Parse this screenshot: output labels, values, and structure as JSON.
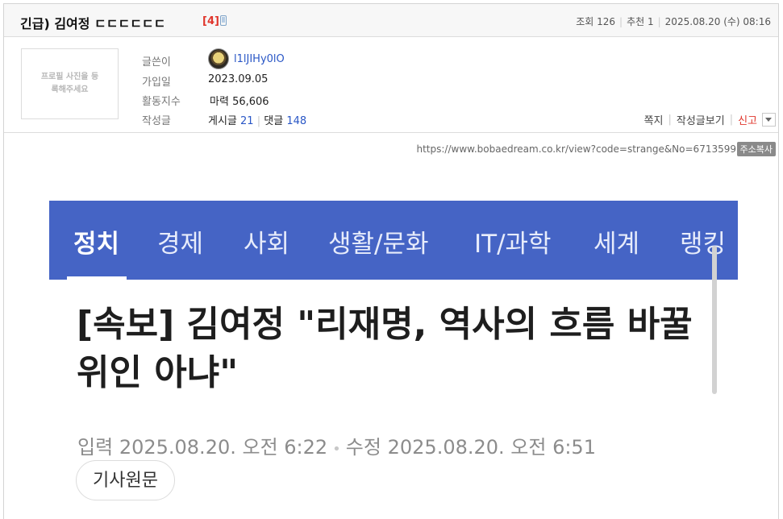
{
  "post": {
    "title": "긴급) 김여정 ㄷㄷㄷㄷㄷㄷ",
    "comment_count": "[4]",
    "views_label": "조회 126",
    "recommend_label": "추천 1",
    "datetime": "2025.08.20 (수) 08:16"
  },
  "author": {
    "profile_placeholder": "프로필 사진을 등록해주세요",
    "labels": {
      "writer": "글쓴이",
      "joined": "가입일",
      "activity": "활동지수",
      "posts": "작성글"
    },
    "nickname": "l1lJIHy0lO",
    "joined": "2023.09.05",
    "activity_label": "마력",
    "activity_value": "56,606",
    "post_label": "게시글",
    "post_count": "21",
    "comment_label": "댓글",
    "comment_count": "148"
  },
  "actions": {
    "message": "쪽지",
    "view_posts": "작성글보기",
    "report": "신고"
  },
  "url": {
    "text": "https://www.bobaedream.co.kr/view?code=strange&No=6713599",
    "copy_label": "주소복사"
  },
  "news": {
    "nav": [
      "정치",
      "경제",
      "사회",
      "생활/문화",
      "IT/과학",
      "세계",
      "랭킹"
    ],
    "headline": "[속보] 김여정 \"리재명, 역사의 흐름 바꿀 위인 아냐\"",
    "input_label": "입력",
    "input_time": "2025.08.20. 오전 6:22",
    "edit_label": "수정",
    "edit_time": "2025.08.20. 오전 6:51",
    "source_button": "기사원문"
  },
  "colors": {
    "nav_bg": "#4564c5",
    "report": "#e0362c",
    "link": "#2a57c6"
  }
}
